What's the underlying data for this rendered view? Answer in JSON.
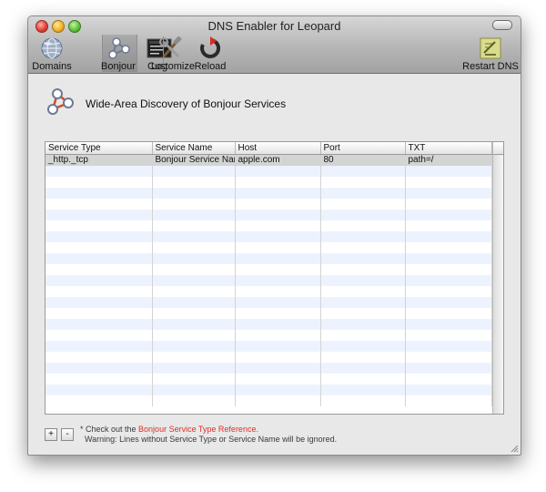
{
  "window": {
    "title": "DNS Enabler for Leopard"
  },
  "toolbar": {
    "items": [
      {
        "label": "Domains",
        "icon": "globe-icon"
      },
      {
        "label": "Bonjour",
        "icon": "bonjour-icon",
        "selected": true
      },
      {
        "label": "Log",
        "icon": "log-console-icon"
      },
      {
        "label": "Customize",
        "icon": "tools-icon"
      },
      {
        "label": "Reload",
        "icon": "reload-icon"
      }
    ],
    "restart": {
      "label": "Restart DNS",
      "icon": "restart-dns-icon"
    }
  },
  "header": {
    "title": "Wide-Area Discovery of Bonjour Services",
    "icon": "bonjour-icon"
  },
  "table": {
    "columns": [
      "Service Type",
      "Service Name",
      "Host",
      "Port",
      "TXT"
    ],
    "rows": [
      [
        "_http._tcp",
        "Bonjour Service Name",
        "apple.com",
        "80",
        "path=/"
      ]
    ]
  },
  "footer": {
    "add_label": "+",
    "remove_label": "-",
    "note_prefix": "* Check out the ",
    "note_link": "Bonjour Service Type Reference.",
    "warning": "Warning: Lines without Service Type or Service Name will be ignored."
  },
  "colors": {
    "link": "#e0302a",
    "row_alt": "#edf3fe",
    "row_selected": "#d4d4d4"
  }
}
